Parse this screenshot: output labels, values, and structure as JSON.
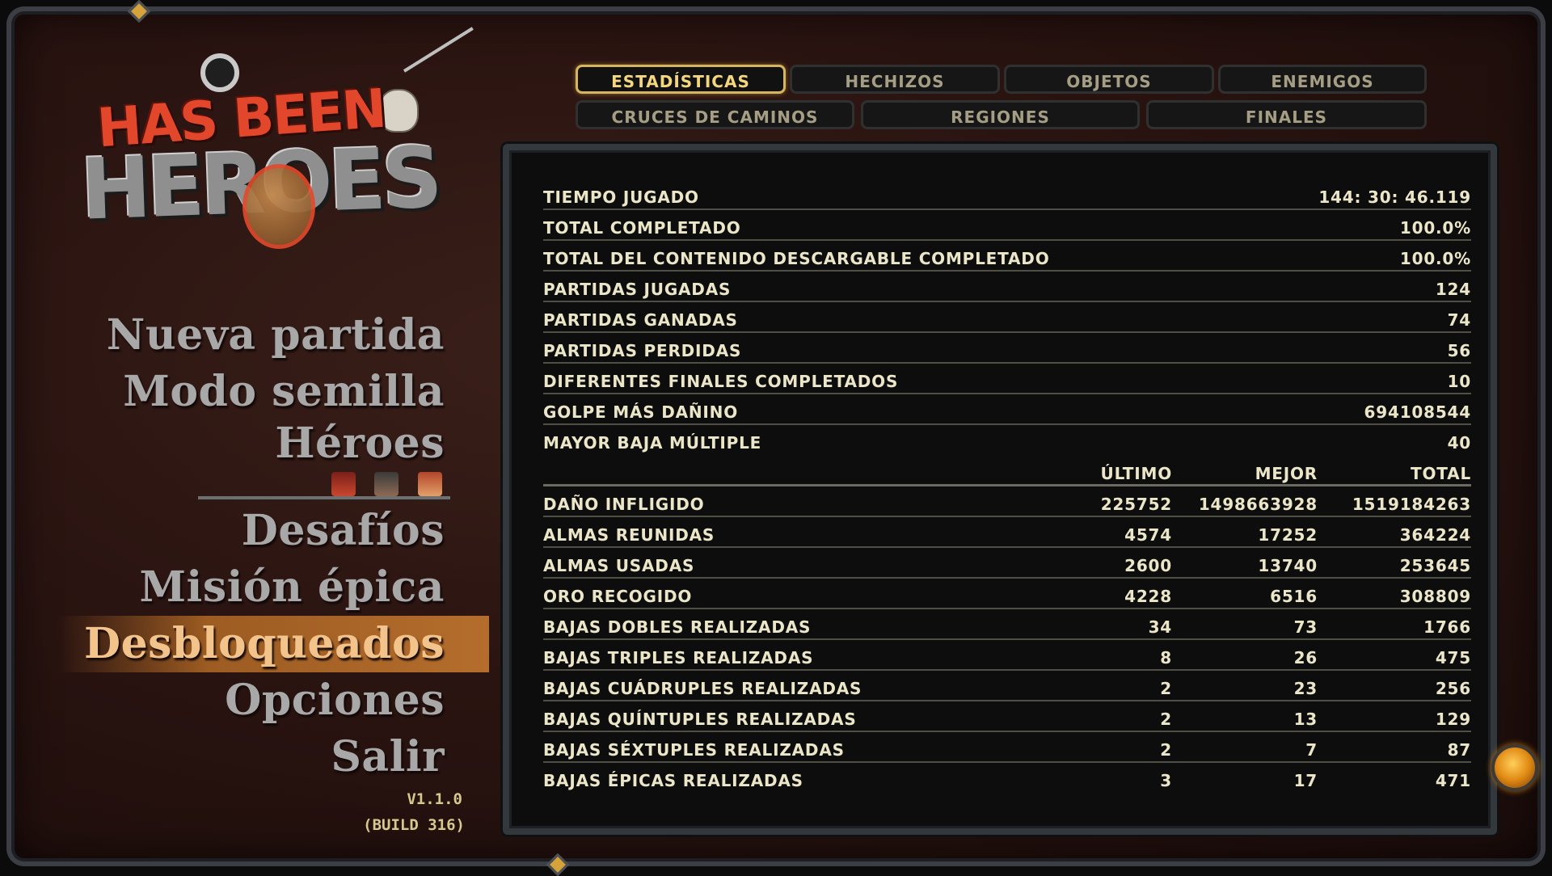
{
  "game": {
    "logo_line1": "HAS BEEN",
    "logo_line2": "HEROES"
  },
  "menu": {
    "items": [
      {
        "label": "Nueva partida",
        "active": false
      },
      {
        "label": "Modo semilla",
        "active": false
      },
      {
        "label": "Héroes",
        "active": false
      },
      {
        "label": "Desafíos",
        "active": false
      },
      {
        "label": "Misión épica",
        "active": false
      },
      {
        "label": "Desbloqueados",
        "active": true
      },
      {
        "label": "Opciones",
        "active": false
      },
      {
        "label": "Salir",
        "active": false
      }
    ],
    "version": "V1.1.0",
    "build": "(BUILD 316)"
  },
  "tabs": {
    "row1": [
      "ESTADÍSTICAS",
      "HECHIZOS",
      "OBJETOS",
      "ENEMIGOS"
    ],
    "row2": [
      "CRUCES DE CAMINOS",
      "REGIONES",
      "FINALES"
    ],
    "active": "ESTADÍSTICAS"
  },
  "stats": {
    "general": [
      {
        "label": "TIEMPO JUGADO",
        "value": "144: 30: 46.119"
      },
      {
        "label": "TOTAL COMPLETADO",
        "value": "100.0%"
      },
      {
        "label": "TOTAL DEL CONTENIDO DESCARGABLE COMPLETADO",
        "value": "100.0%"
      },
      {
        "label": "PARTIDAS JUGADAS",
        "value": "124"
      },
      {
        "label": "PARTIDAS GANADAS",
        "value": "74"
      },
      {
        "label": "PARTIDAS PERDIDAS",
        "value": "56"
      },
      {
        "label": "DIFERENTES FINALES COMPLETADOS",
        "value": "10"
      },
      {
        "label": "GOLPE MÁS DAÑINO",
        "value": "694108544"
      },
      {
        "label": "MAYOR BAJA MÚLTIPLE",
        "value": "40"
      }
    ],
    "columns": [
      "ÚLTIMO",
      "MEJOR",
      "TOTAL"
    ],
    "detailed": [
      {
        "label": "DAÑO INFLIGIDO",
        "last": "225752",
        "best": "1498663928",
        "total": "1519184263"
      },
      {
        "label": "ALMAS REUNIDAS",
        "last": "4574",
        "best": "17252",
        "total": "364224"
      },
      {
        "label": "ALMAS USADAS",
        "last": "2600",
        "best": "13740",
        "total": "253645"
      },
      {
        "label": "ORO RECOGIDO",
        "last": "4228",
        "best": "6516",
        "total": "308809"
      },
      {
        "label": "BAJAS DOBLES REALIZADAS",
        "last": "34",
        "best": "73",
        "total": "1766"
      },
      {
        "label": "BAJAS TRIPLES REALIZADAS",
        "last": "8",
        "best": "26",
        "total": "475"
      },
      {
        "label": "BAJAS CUÁDRUPLES REALIZADAS",
        "last": "2",
        "best": "23",
        "total": "256"
      },
      {
        "label": "BAJAS QUÍNTUPLES REALIZADAS",
        "last": "2",
        "best": "13",
        "total": "129"
      },
      {
        "label": "BAJAS SÉXTUPLES REALIZADAS",
        "last": "2",
        "best": "7",
        "total": "87"
      },
      {
        "label": "BAJAS ÉPICAS REALIZADAS",
        "last": "3",
        "best": "17",
        "total": "471"
      }
    ]
  },
  "colors": {
    "accent_gold": "#d7b45e",
    "menu_active": "#b46d2c",
    "text_stats": "#ece6c8"
  }
}
